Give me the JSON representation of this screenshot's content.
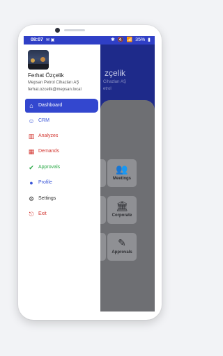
{
  "status_bar": {
    "time": "08:07",
    "left_icons": "✉ ▣",
    "right_icons": [
      "✱",
      "🔇",
      "📶",
      "▮"
    ],
    "battery": "35%"
  },
  "drawer": {
    "user": {
      "name": "Ferhat Özçelik",
      "company": "Mepsan Petrol Cihazları AŞ",
      "email": "ferhat.ozcelik@mepsan.local"
    },
    "menu": [
      {
        "label": "Dashboard",
        "icon": "home-icon",
        "active": true
      },
      {
        "label": "CRM",
        "icon": "handshake-icon",
        "active": false
      },
      {
        "label": "Analyzes",
        "icon": "chart-icon",
        "active": false
      },
      {
        "label": "Demands",
        "icon": "demands-icon",
        "active": false
      },
      {
        "label": "Approvals",
        "icon": "check-circle-icon",
        "active": false
      },
      {
        "label": "Profile",
        "icon": "person-icon",
        "active": false
      },
      {
        "label": "Settings",
        "icon": "gear-icon",
        "active": false
      },
      {
        "label": "Exit",
        "icon": "logout-icon",
        "active": false
      }
    ]
  },
  "background_app": {
    "header_name": "zçelik",
    "header_sub": "Cihazları AŞ",
    "header_sub2": "etrol",
    "cards": [
      {
        "label": "Meetings",
        "icon": "meetings-icon"
      },
      {
        "label": "Corporate",
        "icon": "corporate-icon"
      },
      {
        "label": "Approvals",
        "icon": "approvals-icon"
      }
    ]
  },
  "colors": {
    "primary": "#3347cf",
    "header": "#1e2a8a",
    "danger": "#d2352f",
    "success": "#27a844"
  }
}
